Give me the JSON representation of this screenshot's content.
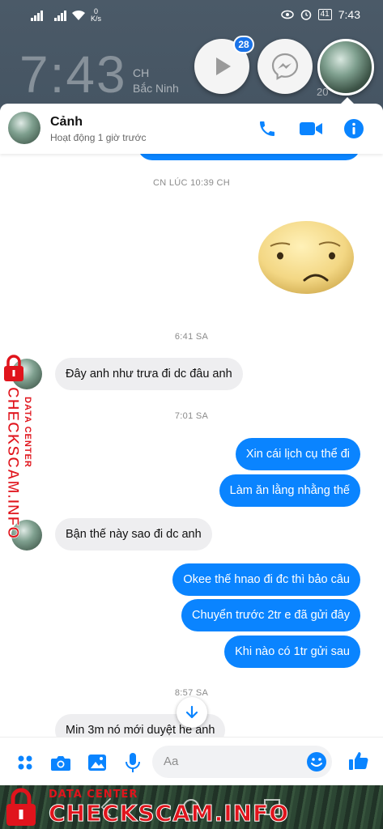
{
  "status_bar": {
    "net_speed_value": "0",
    "net_speed_unit": "K/s",
    "battery": "41",
    "time": "7:43"
  },
  "lockscreen": {
    "clock": "7:43",
    "ampm": "CH",
    "location": "Bắc Ninh",
    "date_fragment": "20"
  },
  "chat_heads": {
    "play_badge": "28"
  },
  "header": {
    "name": "Cảnh",
    "status": "Hoạt động 1 giờ trước"
  },
  "messages": [
    {
      "type": "timestamp",
      "text": "CN LÚC 10:39 CH"
    },
    {
      "type": "sticker",
      "name": "worried-face-sticker"
    },
    {
      "type": "timestamp",
      "text": "6:41 SA"
    },
    {
      "type": "incoming",
      "text": "Đây anh như trưa đi dc đâu anh"
    },
    {
      "type": "timestamp",
      "text": "7:01 SA"
    },
    {
      "type": "outgoing",
      "text": "Xin cái lịch cụ thể đi"
    },
    {
      "type": "outgoing",
      "text": "Làm ăn lằng nhằng thế"
    },
    {
      "type": "incoming",
      "text": "Bận thế này sao đi dc anh"
    },
    {
      "type": "outgoing",
      "text": "Okee thế hnao đi đc thì bảo câu"
    },
    {
      "type": "outgoing",
      "text": "Chuyển trước 2tr e đã gửi đây"
    },
    {
      "type": "outgoing",
      "text": "Khi nào có 1tr gửi sau"
    },
    {
      "type": "timestamp",
      "text": "8:57 SA"
    },
    {
      "type": "incoming",
      "text": "Min 3m nó mới duyệt hề anh"
    }
  ],
  "composer": {
    "placeholder": "Aa"
  },
  "watermark": {
    "line1": "DATA CENTER",
    "line2": "CHECKSCAM.INFO"
  },
  "colors": {
    "accent": "#0a84ff",
    "incoming_bubble": "#eeeef0",
    "watermark_red": "#e0141c"
  }
}
